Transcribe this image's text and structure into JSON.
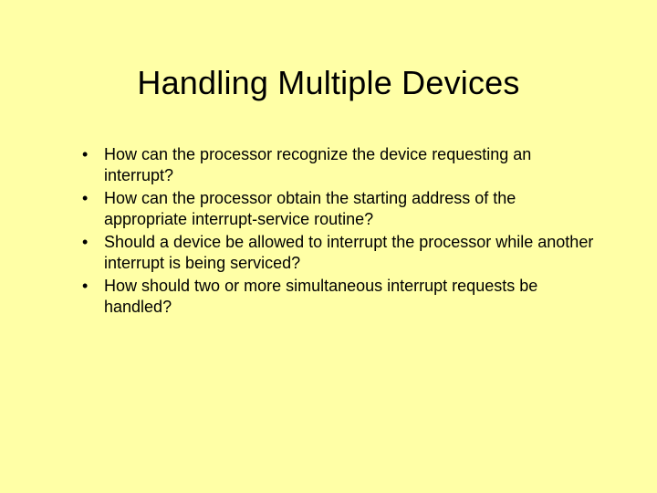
{
  "title": "Handling Multiple Devices",
  "bullets": [
    "How can the processor recognize the device requesting an interrupt?",
    "How can the processor obtain the starting address of the appropriate interrupt-service routine?",
    "Should a device be allowed to interrupt the processor while another interrupt is being serviced?",
    "How should two or more simultaneous interrupt requests be handled?"
  ]
}
